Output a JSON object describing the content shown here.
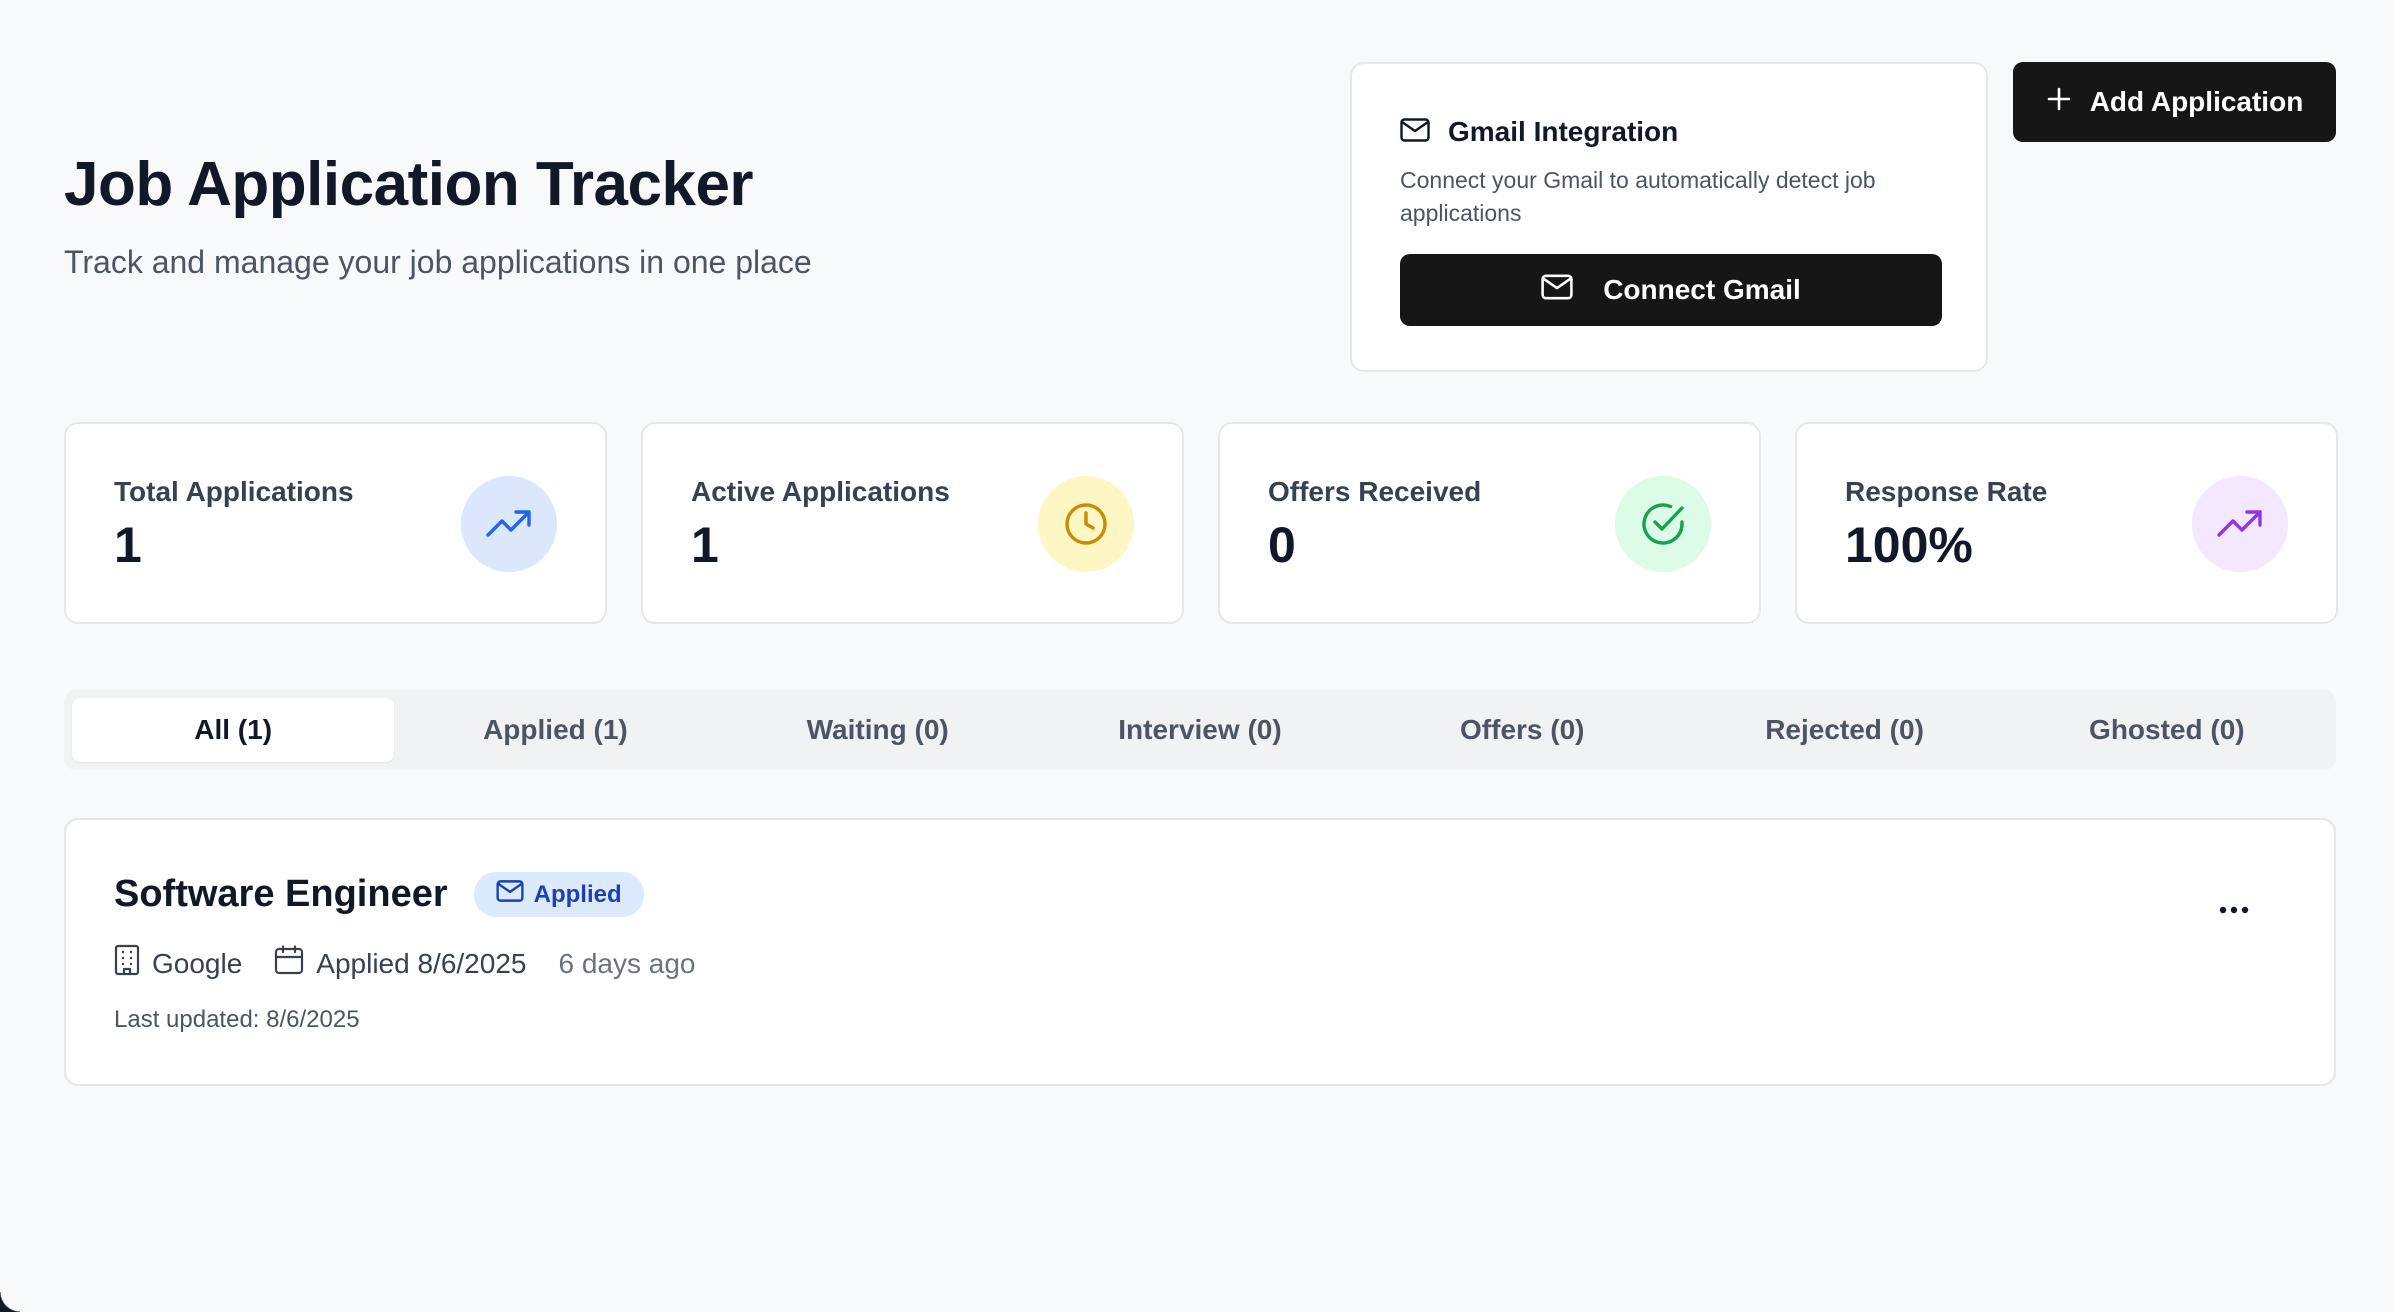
{
  "header": {
    "title": "Job Application Tracker",
    "subtitle": "Track and manage your job applications in one place"
  },
  "gmail": {
    "title": "Gmail Integration",
    "description": "Connect your Gmail to automatically detect job applications",
    "connect_label": "Connect Gmail"
  },
  "actions": {
    "add_label": "Add Application"
  },
  "stats": [
    {
      "label": "Total Applications",
      "value": "1",
      "icon": "trending-up-icon",
      "icon_bg": "#dbe7fd",
      "icon_color": "#2563eb"
    },
    {
      "label": "Active Applications",
      "value": "1",
      "icon": "clock-icon",
      "icon_bg": "#fef7c3",
      "icon_color": "#ca8a04"
    },
    {
      "label": "Offers Received",
      "value": "0",
      "icon": "check-circle-icon",
      "icon_bg": "#dcfce7",
      "icon_color": "#16a34a"
    },
    {
      "label": "Response Rate",
      "value": "100%",
      "icon": "trending-up-icon",
      "icon_bg": "#f3e8ff",
      "icon_color": "#9333ea"
    }
  ],
  "tabs": [
    {
      "label": "All (1)",
      "active": true
    },
    {
      "label": "Applied (1)",
      "active": false
    },
    {
      "label": "Waiting (0)",
      "active": false
    },
    {
      "label": "Interview (0)",
      "active": false
    },
    {
      "label": "Offers (0)",
      "active": false
    },
    {
      "label": "Rejected (0)",
      "active": false
    },
    {
      "label": "Ghosted (0)",
      "active": false
    }
  ],
  "applications": [
    {
      "title": "Software Engineer",
      "status": "Applied",
      "company": "Google",
      "applied": "Applied 8/6/2025",
      "ago": "6 days ago",
      "last_updated": "Last updated: 8/6/2025",
      "more": "..."
    }
  ],
  "colors": {
    "accent_dark": "#161616",
    "badge_bg": "#dbeafe",
    "badge_text": "#1e40af"
  }
}
